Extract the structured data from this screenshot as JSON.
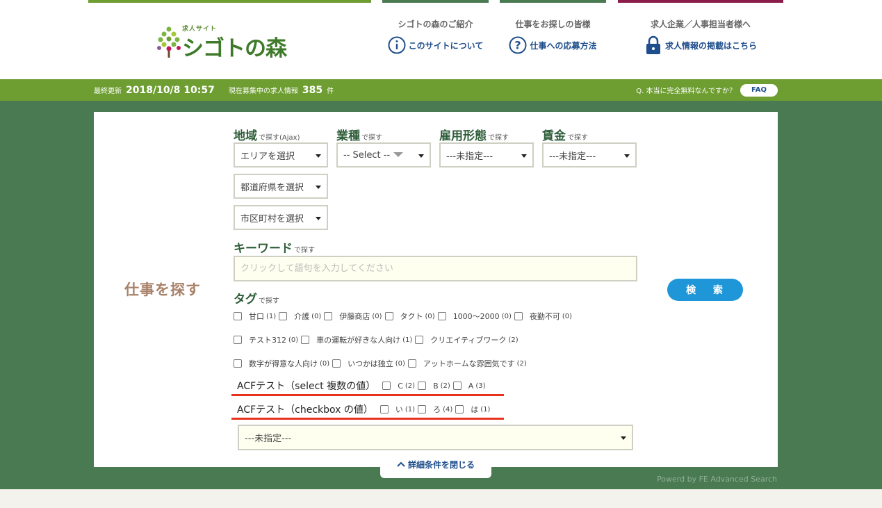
{
  "header": {
    "logo_small": "求人サイト",
    "logo_text": "シゴトの森",
    "nav": [
      {
        "title": "シゴトの森のご紹介",
        "link": "このサイトについて",
        "icon": "info-icon"
      },
      {
        "title": "仕事をお探しの皆様",
        "link": "仕事への応募方法",
        "icon": "question-icon"
      },
      {
        "title": "求人企業／人事担当者様へ",
        "link": "求人情報の掲載はこちら",
        "icon": "lock-icon"
      }
    ],
    "bar_colors": [
      "#6e9e32",
      "#4a7a52",
      "#4a7a52",
      "#8c1d4a"
    ]
  },
  "infobar": {
    "updated_label": "最終更新",
    "updated_value": "2018/10/8 10:57",
    "count_label": "現在募集中の求人情報",
    "count_value": "385",
    "count_unit": "件",
    "question": "Q. 本当に完全無料なんですか？",
    "faq": "FAQ"
  },
  "search": {
    "side_title": "仕事を探す",
    "region": {
      "label": "地域",
      "sub": "で探す(Ajax)",
      "area": "エリアを選択",
      "pref": "都道府県を選択",
      "city": "市区町村を選択"
    },
    "industry": {
      "label": "業種",
      "sub": "で探す",
      "value": "-- Select --"
    },
    "employment": {
      "label": "雇用形態",
      "sub": "で探す",
      "value": "---未指定---"
    },
    "wage": {
      "label": "賃金",
      "sub": "で探す",
      "value": "---未指定---"
    },
    "keyword": {
      "label": "キーワード",
      "sub": "で探す",
      "placeholder": "クリックして語句を入力してください"
    },
    "tag": {
      "label": "タグ",
      "sub": "で探す"
    },
    "tags_row1": [
      {
        "name": "甘口",
        "count": "(1)"
      },
      {
        "name": "介護",
        "count": "(0)"
      },
      {
        "name": "伊藤商店",
        "count": "(0)"
      },
      {
        "name": "タクト",
        "count": "(0)"
      },
      {
        "name": "1000〜2000",
        "count": "(0)"
      },
      {
        "name": "夜勤不可",
        "count": "(0)"
      }
    ],
    "tags_row2": [
      {
        "name": "テスト312",
        "count": "(0)"
      },
      {
        "name": "車の運転が好きな人向け",
        "count": "(1)"
      },
      {
        "name": "クリエイティブワーク",
        "count": "(2)"
      }
    ],
    "tags_row3": [
      {
        "name": "数字が得意な人向け",
        "count": "(0)"
      },
      {
        "name": "いつかは独立",
        "count": "(0)"
      },
      {
        "name": "アットホームな雰囲気です",
        "count": "(2)"
      }
    ],
    "acf_select": {
      "label": "ACFテスト（select 複数の値）",
      "options": [
        {
          "name": "C",
          "count": "(2)"
        },
        {
          "name": "B",
          "count": "(2)"
        },
        {
          "name": "A",
          "count": "(3)"
        }
      ]
    },
    "acf_checkbox": {
      "label": "ACFテスト（checkbox の値）",
      "options": [
        {
          "name": "い",
          "count": "(1)"
        },
        {
          "name": "ろ",
          "count": "(4)"
        },
        {
          "name": "は",
          "count": "(1)"
        }
      ]
    },
    "bottom_select": "---未指定---",
    "search_button": "検 索",
    "close_label": "詳細条件を閉じる"
  },
  "footer": {
    "powered": "Powerd by FE Advanced Search"
  }
}
